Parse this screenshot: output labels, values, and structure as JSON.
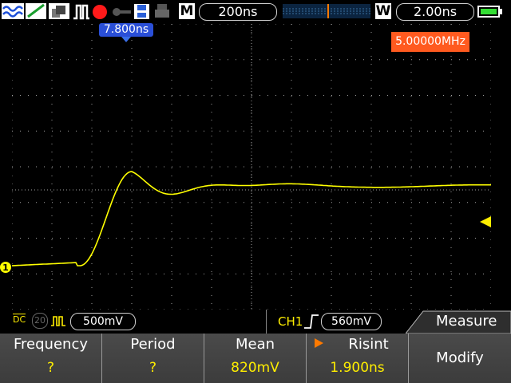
{
  "topbar": {
    "icons": [
      "run-state-waves-icon",
      "cursor-slope-icon",
      "display-persistence-icon",
      "waveform-mode-icon",
      "record-icon",
      "key-icon",
      "save-icon",
      "printer-icon"
    ],
    "m_label": "M",
    "timebase": "200ns",
    "w_label": "W",
    "window_timebase": "2.00ns",
    "battery": "battery-full-icon"
  },
  "screen": {
    "trigger_position": "7.800ns",
    "frequency_readout": "5.00000MHz",
    "channel_marker": "1",
    "trace_color": "#ffff00",
    "grid_color": "#a0a0a0",
    "trigger_level_color": "#ffee00"
  },
  "chbar": {
    "coupling": "DC",
    "bw_limit": "20",
    "scale": "500mV",
    "trigger_source": "CH1",
    "trigger_level": "560mV",
    "menu_title": "Measure"
  },
  "menu": {
    "items": [
      {
        "label": "Frequency",
        "value": "?"
      },
      {
        "label": "Period",
        "value": "?"
      },
      {
        "label": "Mean",
        "value": "820mV"
      },
      {
        "label": "Risint",
        "value": "1.900ns"
      },
      {
        "label": "Modify",
        "value": ""
      }
    ]
  }
}
